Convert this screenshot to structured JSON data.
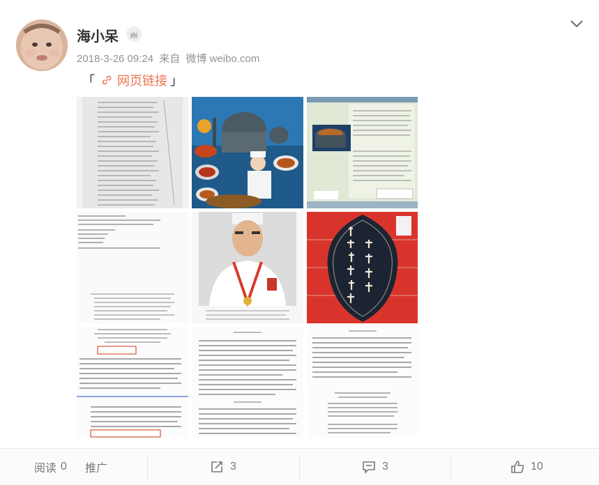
{
  "post": {
    "author": "海小呆",
    "date": "2018-3-26 09:24",
    "source_prefix": "来自",
    "source": "微博 weibo.com",
    "bracket_open": "「",
    "bracket_close": "」",
    "link_text": "网页链接"
  },
  "images": [
    {
      "icon": "book-index-page"
    },
    {
      "icon": "mosque-cuisine-cover"
    },
    {
      "icon": "book-back-cover-pot"
    },
    {
      "icon": "copyright-page"
    },
    {
      "icon": "chef-portrait"
    },
    {
      "icon": "beijing-halal-cover"
    },
    {
      "icon": "recipe-page"
    },
    {
      "icon": "recipe-page"
    },
    {
      "icon": "introduction-page"
    }
  ],
  "footer": {
    "read_label": "阅读",
    "read_count": "0",
    "promote_label": "推广",
    "share_count": "3",
    "comment_count": "3",
    "like_count": "10"
  },
  "colors": {
    "accent": "#eb7350",
    "text": "#333333",
    "meta": "#939393"
  }
}
